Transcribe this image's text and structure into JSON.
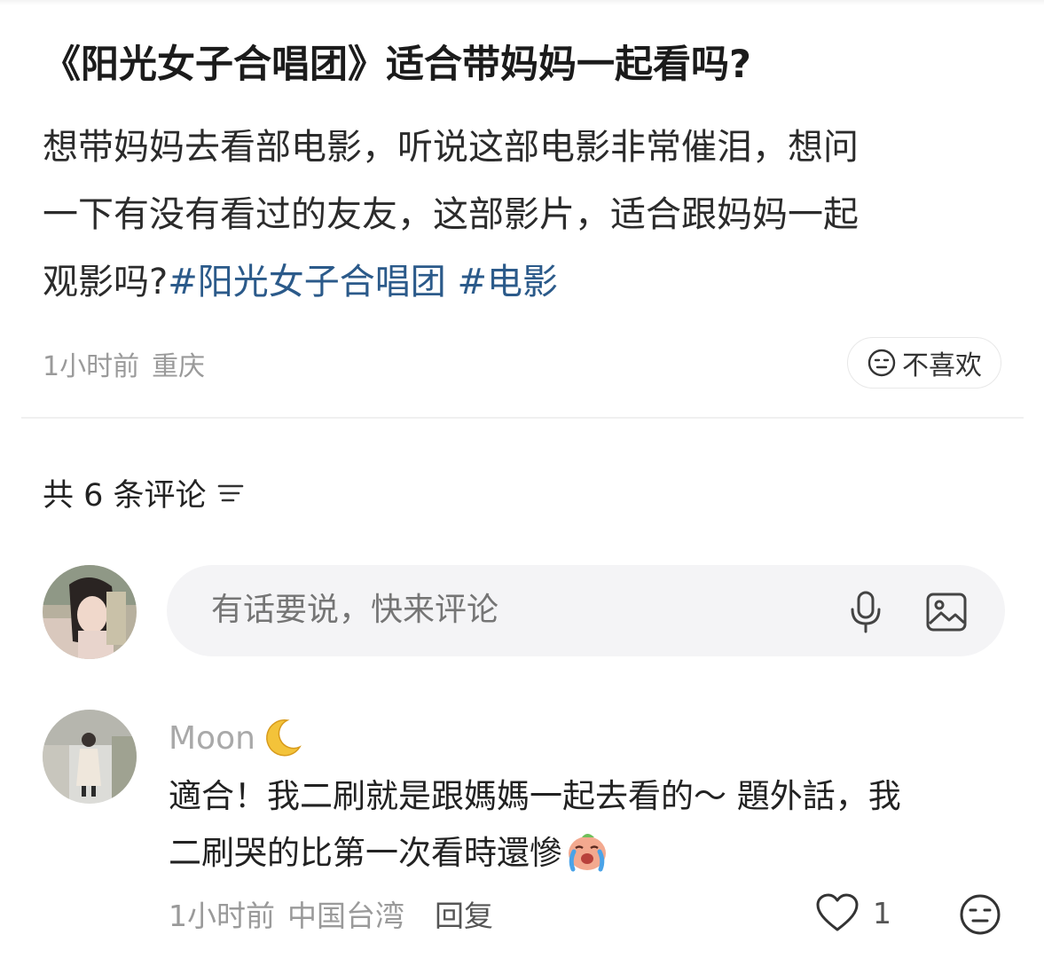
{
  "post": {
    "title": "《阳光女子合唱团》适合带妈妈一起看吗?",
    "body_line1": "想带妈妈去看部电影，听说这部电影非常催泪，想问",
    "body_line2": "一下有没有看过的友友，这部影片，适合跟妈妈一起",
    "body_line3": "观影吗?",
    "tags": [
      "#阳光女子合唱团",
      "#电影"
    ],
    "time": "1小时前",
    "location": "重庆",
    "dislike_label": "不喜欢"
  },
  "comments_header": {
    "count_label": "共 6 条评论",
    "sort_icon": "sort-icon"
  },
  "comment_input": {
    "placeholder": "有话要说，快来评论",
    "icons": [
      "microphone-icon",
      "image-icon"
    ]
  },
  "comments": [
    {
      "user": "Moon",
      "name_emoji": "crescent-moon-emoji",
      "text_line1": "適合！我二刷就是跟媽媽一起去看的～ 題外話，我",
      "text_line2": "二刷哭的比第一次看時還慘",
      "text_emoji": "crying-emoji",
      "time": "1小时前",
      "location": "中国台湾",
      "reply_label": "回复",
      "likes": "1"
    }
  ],
  "colors": {
    "tag": "#2b5a8a",
    "meta_text": "#9a9a9a",
    "input_bg": "#f4f4f6"
  }
}
